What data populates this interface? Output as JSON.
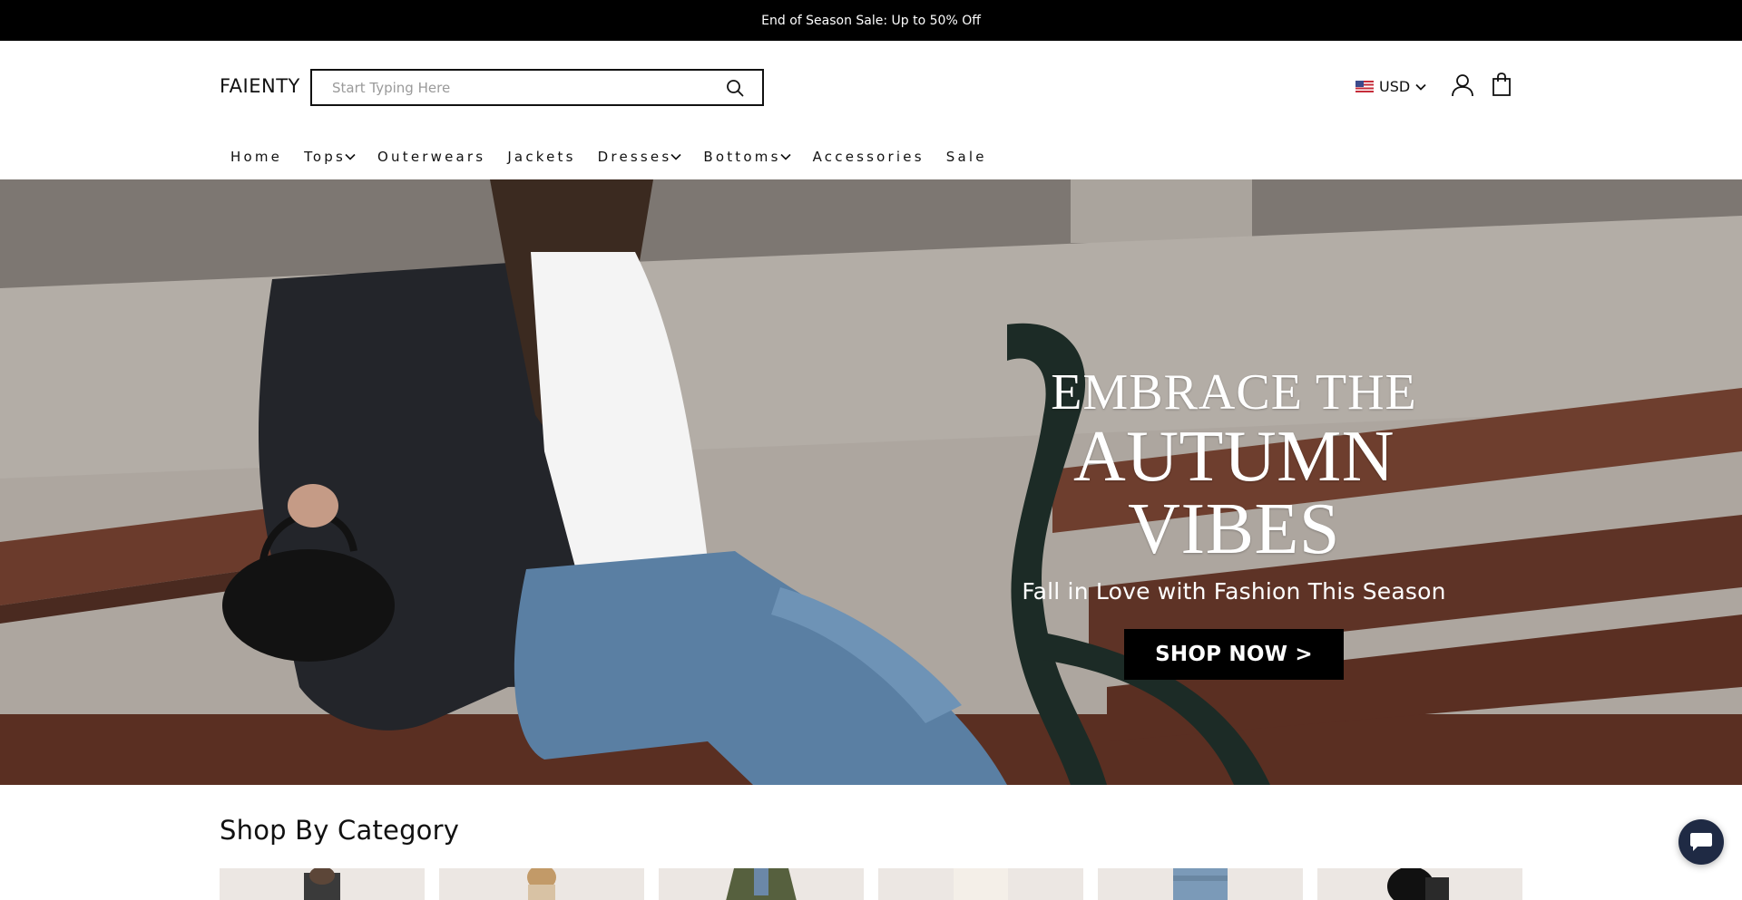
{
  "announcement": {
    "text": "End of Season Sale: Up to 50% Off"
  },
  "header": {
    "logo": "FAIENTY",
    "search": {
      "placeholder": "Start Typing Here",
      "value": ""
    },
    "currency": {
      "code": "USD",
      "flag": "us-flag-icon"
    },
    "icons": [
      "search-icon",
      "account-icon",
      "cart-icon",
      "chevron-down-icon"
    ]
  },
  "nav": {
    "items": [
      {
        "label": "Home",
        "dropdown": false
      },
      {
        "label": "Tops",
        "dropdown": true
      },
      {
        "label": "Outerwears",
        "dropdown": false
      },
      {
        "label": "Jackets",
        "dropdown": false
      },
      {
        "label": "Dresses",
        "dropdown": true
      },
      {
        "label": "Bottoms",
        "dropdown": true
      },
      {
        "label": "Accessories",
        "dropdown": false
      },
      {
        "label": "Sale",
        "dropdown": false
      }
    ]
  },
  "hero": {
    "line1": "EMBRACE THE",
    "line2": "AUTUMN VIBES",
    "tagline": "Fall in Love with Fashion This Season",
    "cta": "SHOP NOW >"
  },
  "categories": {
    "title": "Shop By Category",
    "cards": [
      {
        "name": "category-card-1"
      },
      {
        "name": "category-card-2"
      },
      {
        "name": "category-card-3"
      },
      {
        "name": "category-card-4"
      },
      {
        "name": "category-card-5"
      },
      {
        "name": "category-card-6"
      }
    ]
  },
  "chat": {
    "icon": "chat-icon"
  },
  "colors": {
    "announcement_bg": "#000000",
    "text": "#111111",
    "cta_bg": "#000000",
    "chat_bg": "#1f2a44"
  }
}
